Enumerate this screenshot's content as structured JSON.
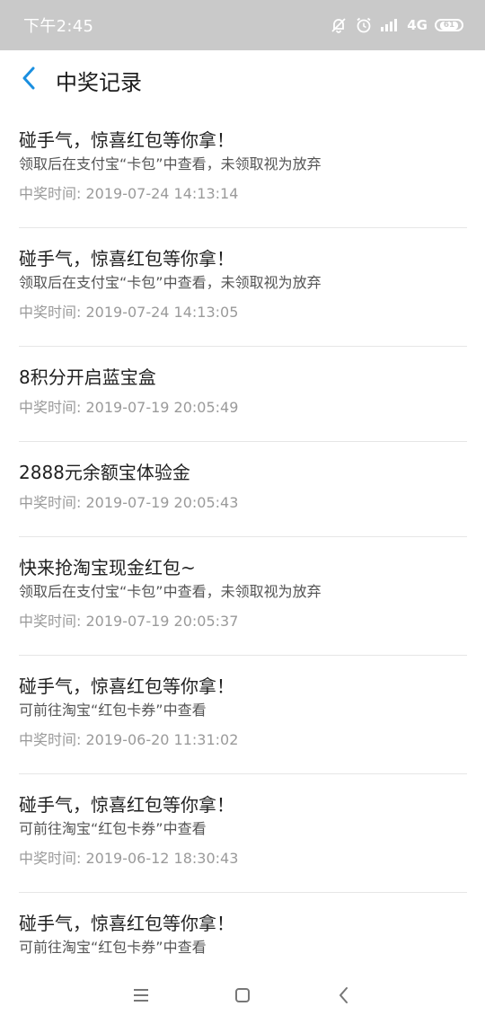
{
  "status_bar": {
    "time": "下午2:45",
    "network": "4G",
    "battery": "61"
  },
  "header": {
    "title": "中奖记录"
  },
  "records": [
    {
      "title": "碰手气，惊喜红包等你拿！",
      "desc": "领取后在支付宝“卡包”中查看，未领取视为放弃",
      "time": "中奖时间: 2019-07-24 14:13:14"
    },
    {
      "title": "碰手气，惊喜红包等你拿！",
      "desc": "领取后在支付宝“卡包”中查看，未领取视为放弃",
      "time": "中奖时间: 2019-07-24 14:13:05"
    },
    {
      "title": "8积分开启蓝宝盒",
      "desc": "",
      "time": "中奖时间: 2019-07-19 20:05:49"
    },
    {
      "title": "2888元余额宝体验金",
      "desc": "",
      "time": "中奖时间: 2019-07-19 20:05:43"
    },
    {
      "title": "快来抢淘宝现金红包~",
      "desc": "领取后在支付宝“卡包”中查看，未领取视为放弃",
      "time": "中奖时间: 2019-07-19 20:05:37"
    },
    {
      "title": "碰手气，惊喜红包等你拿！",
      "desc": "可前往淘宝“红包卡券”中查看",
      "time": "中奖时间: 2019-06-20 11:31:02"
    },
    {
      "title": "碰手气，惊喜红包等你拿！",
      "desc": "可前往淘宝“红包卡券”中查看",
      "time": "中奖时间: 2019-06-12 18:30:43"
    },
    {
      "title": "碰手气，惊喜红包等你拿！",
      "desc": "可前往淘宝“红包卡券”中查看",
      "time": ""
    }
  ],
  "colors": {
    "status_bar_bg": "#c9c9c9",
    "back_arrow": "#1a8fe0"
  },
  "icons": {
    "back": "chevron-left-icon",
    "menu": "menu-icon",
    "home": "home-square-icon",
    "nav_back": "nav-back-icon"
  }
}
